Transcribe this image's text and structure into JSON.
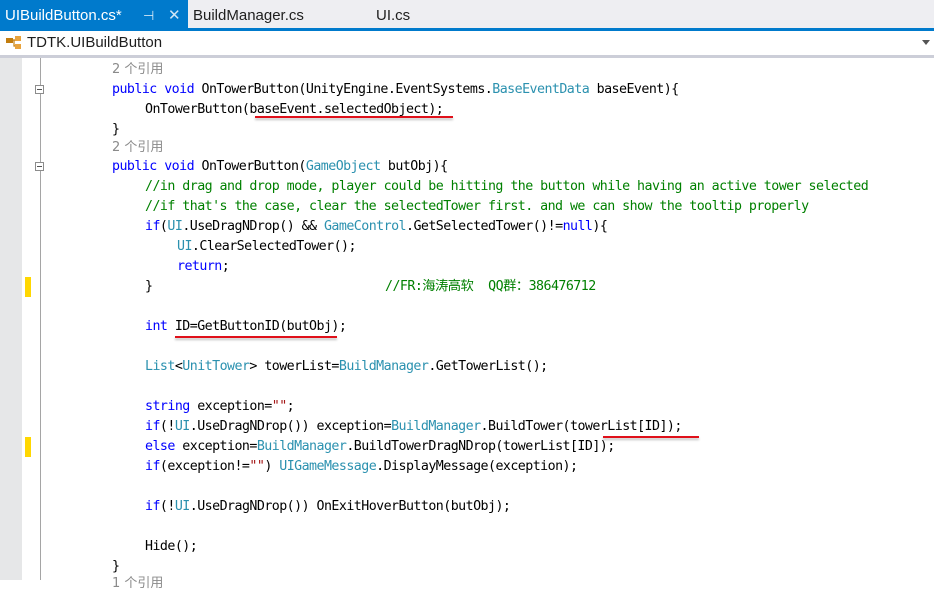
{
  "tabs": [
    {
      "label": "UIBuildButton.cs*",
      "active": true,
      "pin_icon": "pin-icon",
      "close_icon": "close-icon"
    },
    {
      "label": "BuildManager.cs",
      "active": false
    },
    {
      "label": "UI.cs",
      "active": false
    }
  ],
  "navbar": {
    "class_icon": "class-icon",
    "label": "TDTK.UIBuildButton",
    "dropdown_icon": "chevron-down-icon"
  },
  "colors": {
    "accent": "#007acc",
    "keyword": "#0000ff",
    "type": "#2b91af",
    "comment": "#008000",
    "string": "#a31515",
    "change_marker": "#ffd700",
    "annotation_underline": "#e0101a"
  },
  "code": {
    "ref1": "2 个引用",
    "l1": {
      "kw1": "public",
      "kw2": "void",
      "a": " OnTowerButton(UnityEngine.EventSystems.",
      "ty": "BaseEventData",
      "b": " baseEvent){"
    },
    "l2": {
      "a": "OnTowerButton(",
      "u": "baseEvent.selectedObject",
      "b": ");"
    },
    "l3": "}",
    "ref2": "2 个引用",
    "l4": {
      "kw1": "public",
      "kw2": "void",
      "a": " OnTowerButton(",
      "ty": "GameObject",
      "b": " butObj){"
    },
    "c1": "//in drag and drop mode, player could be hitting the button while having an active tower selected",
    "c2": "//if that's the case, clear the selectedTower first. and we can show the tooltip properly",
    "l5": {
      "kw": "if",
      "a": "(",
      "ty1": "UI",
      "b": ".UseDragNDrop() && ",
      "ty2": "GameControl",
      "c": ".GetSelectedTower()!=",
      "kw2": "null",
      "d": "){"
    },
    "l6": {
      "ty": "UI",
      "a": ".ClearSelectedTower();"
    },
    "l7": {
      "kw": "return",
      "a": ";"
    },
    "l8": {
      "a": "}",
      "cm": "//FR:海涛高软  QQ群：386476712"
    },
    "l9": {
      "kw": "int",
      "u": "ID=GetButtonID(butObj)",
      "b": ";"
    },
    "l10": {
      "ty1": "List",
      "a": "<",
      "ty2": "UnitTower",
      "b": "> towerList=",
      "ty3": "BuildManager",
      "c": ".GetTowerList();"
    },
    "l11": {
      "kw": "string",
      "a": " exception=",
      "st": "\"\"",
      "b": ";"
    },
    "l12": {
      "kw": "if",
      "a": "(!",
      "ty1": "UI",
      "b": ".UseDragNDrop()) exception=",
      "ty2": "BuildManager",
      "c": ".BuildTower(",
      "u": "towerList[ID]",
      "d": ");"
    },
    "l13": {
      "kw": "else",
      "a": " exception=",
      "ty": "BuildManager",
      "b": ".BuildTowerDragNDrop(towerList[ID]);"
    },
    "l14": {
      "kw": "if",
      "a": "(exception!=",
      "st": "\"\"",
      "b": ") ",
      "ty": "UIGameMessage",
      "c": ".DisplayMessage(exception);"
    },
    "l15": {
      "kw": "if",
      "a": "(!",
      "ty": "UI",
      "b": ".UseDragNDrop()) OnExitHoverButton(butObj);"
    },
    "l16": "Hide();",
    "l17": "}",
    "ref3": "1 个引用"
  }
}
